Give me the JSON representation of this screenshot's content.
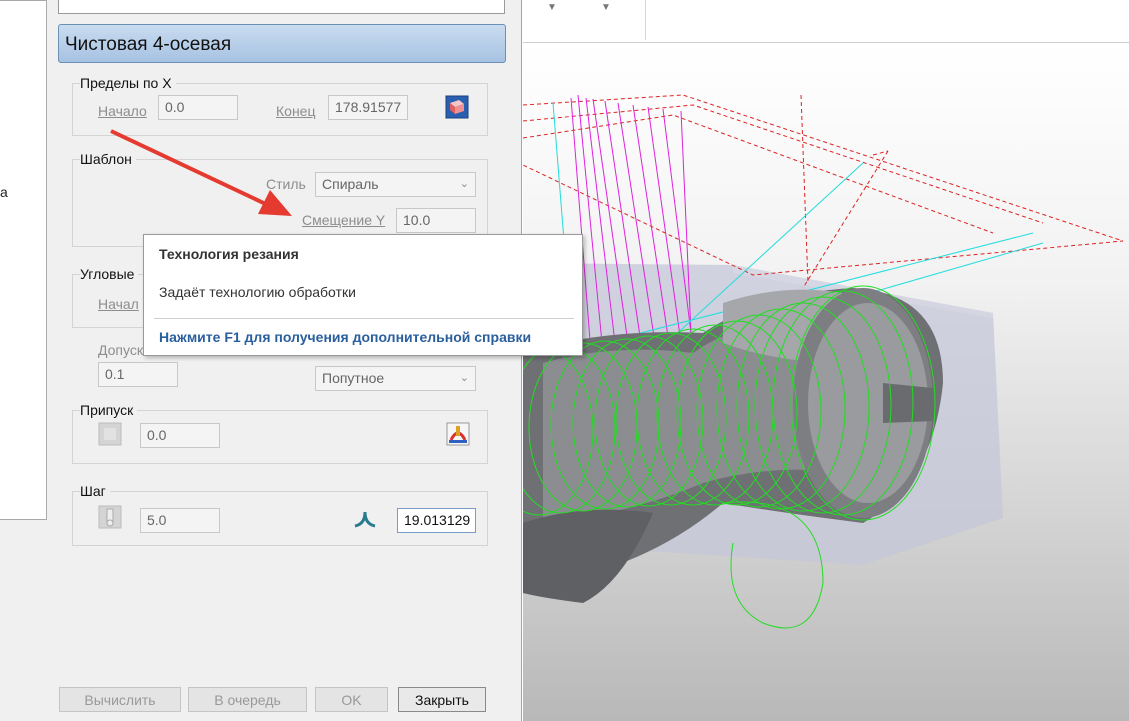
{
  "dialog": {
    "title": "Чистовая 4-осевая",
    "tree_letter": "а",
    "x_limits": {
      "title": "Пределы по X",
      "start_label": "Начало",
      "start_value": "0.0",
      "end_label": "Конец",
      "end_value": "178.91577",
      "icon": "bounding-box-icon"
    },
    "template": {
      "title": "Шаблон",
      "style_label": "Стиль",
      "style_value": "Спираль",
      "offset_label": "Смещение Y",
      "offset_value": "10.0"
    },
    "angular": {
      "title": "Угловые",
      "start_label": "Начал"
    },
    "tolerance": {
      "label": "Допуск",
      "value": "0.1",
      "direction_value": "Попутное"
    },
    "allowance": {
      "title": "Припуск",
      "value": "0.0",
      "icon": "allowance-icon"
    },
    "step": {
      "title": "Шаг",
      "value": "5.0",
      "right_value": "19.013129",
      "icon": "tool-icon"
    },
    "buttons": {
      "calculate": "Вычислить",
      "queue": "В очередь",
      "ok": "OK",
      "close": "Закрыть"
    }
  },
  "tooltip": {
    "title": "Технология резания",
    "body": "Задаёт технологию обработки",
    "help": "Нажмите F1 для получения дополнительной справки"
  },
  "colors": {
    "title_bar": "#b6cde8",
    "arrow": "#e53a2f",
    "toolpath_green": "#22dd22",
    "toolpath_magenta": "#dd22dd",
    "toolpath_cyan": "#22dddd",
    "boundary_red": "#dd2222"
  }
}
